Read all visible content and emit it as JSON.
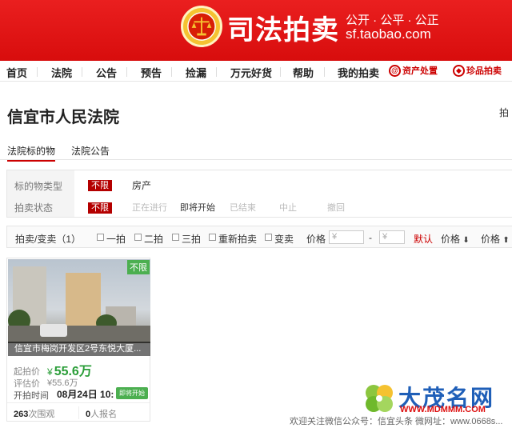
{
  "header": {
    "logo_title": "司法拍卖",
    "slogan": "公开 · 公平 · 公正",
    "domain": "sf.taobao.com"
  },
  "nav": {
    "items": [
      "首页",
      "法院",
      "公告",
      "预告",
      "捡漏",
      "万元好货",
      "帮助",
      "我的拍卖"
    ],
    "asset_disposal": "资产处置",
    "treasure_auction": "珍品拍卖"
  },
  "court": {
    "title": "信宜市人民法院",
    "right_cut": "拍"
  },
  "tabs": [
    "法院标的物",
    "法院公告"
  ],
  "filter": {
    "type_label": "标的物类型",
    "type_unlimited": "不限",
    "type_option": "房产",
    "status_label": "拍卖状态",
    "status_unlimited": "不限",
    "status_options": [
      "正在进行",
      "即将开始",
      "已结束",
      "中止",
      "撤回"
    ]
  },
  "sortbar": {
    "label": "拍卖/变卖（1）",
    "checks": [
      "一拍",
      "二拍",
      "三拍",
      "重新拍卖",
      "变卖"
    ],
    "price_label": "价格",
    "price_from_placeholder": "¥",
    "dash": "-",
    "price_to_placeholder": "¥",
    "default": "默认",
    "price_down": "价格",
    "price_up": "价格",
    "down_arrow": "⬇",
    "up_arrow": "⬆"
  },
  "card": {
    "badge": "不限",
    "caption": "信宜市梅岗开发区2号东悦大厦...",
    "start_price_label": "起拍价",
    "start_price_yen": "¥",
    "start_price": "55.6万",
    "appraisal_label": "评估价",
    "appraisal": "¥55.6万",
    "start_time_label": "开拍时间",
    "start_time": "08月24日 10:",
    "soon_badge": "即将开始",
    "views_count": "263",
    "views_label": "次围观",
    "signup_count": "0",
    "signup_label": "人报名"
  },
  "watermark": {
    "name": "大茂名网",
    "url": "WWW.MDMMM.COM",
    "footer": "欢迎关注微信公众号：信宜头条 微网址：www.0668s..."
  },
  "colors": {
    "brand_red": "#e60012",
    "accent_green": "#2a9d38",
    "badge_red": "#b40000"
  }
}
